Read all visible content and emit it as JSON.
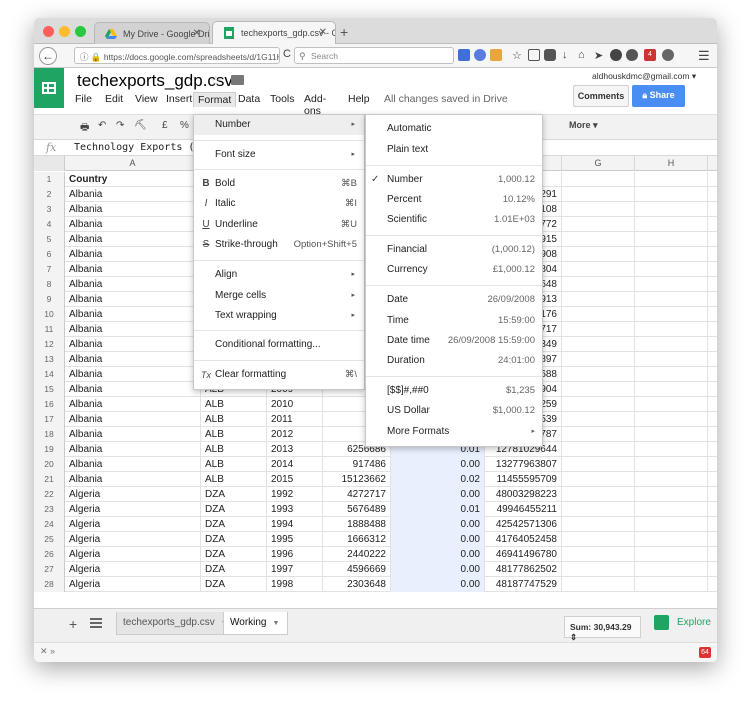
{
  "browser": {
    "tabs": [
      {
        "title": "My Drive - Google Drive"
      },
      {
        "title": "techexports_gdp.csv - Goo..."
      }
    ],
    "url": "https://docs.google.com/spreadsheets/d/1G11H",
    "search_placeholder": "Search",
    "extension_badge": "4",
    "bottom_badge": "64"
  },
  "app": {
    "doc_title": "techexports_gdp.csv",
    "menu": [
      "File",
      "Edit",
      "View",
      "Insert",
      "Format",
      "Data",
      "Tools",
      "Add-ons",
      "Help"
    ],
    "saved_status": "All changes saved in Drive",
    "account_email": "aldhouskdmc@gmail.com",
    "comments_label": "Comments",
    "share_label": "Share"
  },
  "toolbar": {
    "currency": "£",
    "percent": "%",
    "more": "More"
  },
  "formula_bar": {
    "fx": "fx",
    "content": "Technology Exports ($ b"
  },
  "sheet": {
    "column_headers": [
      "A",
      "",
      "",
      "",
      "",
      "",
      "G",
      "H"
    ],
    "rows": [
      {
        "n": "1",
        "a": "Country",
        "b": "",
        "c": "",
        "d": "",
        "e": "",
        "f": ""
      },
      {
        "n": "2",
        "a": "Albania",
        "b": "",
        "c": "",
        "d": "",
        "e": "",
        "f": "291"
      },
      {
        "n": "3",
        "a": "Albania",
        "b": "",
        "c": "",
        "d": "",
        "e": "",
        "f": "108"
      },
      {
        "n": "4",
        "a": "Albania",
        "b": "",
        "c": "",
        "d": "",
        "e": "",
        "f": "772"
      },
      {
        "n": "5",
        "a": "Albania",
        "b": "",
        "c": "",
        "d": "",
        "e": "",
        "f": "915"
      },
      {
        "n": "6",
        "a": "Albania",
        "b": "",
        "c": "",
        "d": "",
        "e": "",
        "f": "908"
      },
      {
        "n": "7",
        "a": "Albania",
        "b": "",
        "c": "",
        "d": "",
        "e": "",
        "f": "804"
      },
      {
        "n": "8",
        "a": "Albania",
        "b": "",
        "c": "",
        "d": "",
        "e": "",
        "f": "648"
      },
      {
        "n": "9",
        "a": "Albania",
        "b": "",
        "c": "",
        "d": "",
        "e": "",
        "f": "913"
      },
      {
        "n": "10",
        "a": "Albania",
        "b": "",
        "c": "",
        "d": "",
        "e": "",
        "f": "176"
      },
      {
        "n": "11",
        "a": "Albania",
        "b": "",
        "c": "",
        "d": "",
        "e": "",
        "f": "717"
      },
      {
        "n": "12",
        "a": "Albania",
        "b": "",
        "c": "",
        "d": "",
        "e": "",
        "f": "349"
      },
      {
        "n": "13",
        "a": "Albania",
        "b": "",
        "c": "",
        "d": "",
        "e": "",
        "f": "897"
      },
      {
        "n": "14",
        "a": "Albania",
        "b": "",
        "c": "",
        "d": "",
        "e": "",
        "f": "688"
      },
      {
        "n": "15",
        "a": "Albania",
        "b": "ALB",
        "c": "2009",
        "d": "583",
        "e": "",
        "f": "904"
      },
      {
        "n": "16",
        "a": "Albania",
        "b": "ALB",
        "c": "2010",
        "d": "858",
        "e": "",
        "f": "259"
      },
      {
        "n": "17",
        "a": "Albania",
        "b": "ALB",
        "c": "2011",
        "d": "620",
        "e": "",
        "f": "539"
      },
      {
        "n": "18",
        "a": "Albania",
        "b": "ALB",
        "c": "2012",
        "d": "481",
        "e": "",
        "f": "787"
      },
      {
        "n": "19",
        "a": "Albania",
        "b": "ALB",
        "c": "2013",
        "d": "6256686",
        "e": "0.01",
        "f": "12781029644"
      },
      {
        "n": "20",
        "a": "Albania",
        "b": "ALB",
        "c": "2014",
        "d": "917486",
        "e": "0.00",
        "f": "13277963807"
      },
      {
        "n": "21",
        "a": "Albania",
        "b": "ALB",
        "c": "2015",
        "d": "15123662",
        "e": "0.02",
        "f": "11455595709"
      },
      {
        "n": "22",
        "a": "Algeria",
        "b": "DZA",
        "c": "1992",
        "d": "4272717",
        "e": "0.00",
        "f": "48003298223"
      },
      {
        "n": "23",
        "a": "Algeria",
        "b": "DZA",
        "c": "1993",
        "d": "5676489",
        "e": "0.01",
        "f": "49946455211"
      },
      {
        "n": "24",
        "a": "Algeria",
        "b": "DZA",
        "c": "1994",
        "d": "1888488",
        "e": "0.00",
        "f": "42542571306"
      },
      {
        "n": "25",
        "a": "Algeria",
        "b": "DZA",
        "c": "1995",
        "d": "1666312",
        "e": "0.00",
        "f": "41764052458"
      },
      {
        "n": "26",
        "a": "Algeria",
        "b": "DZA",
        "c": "1996",
        "d": "2440222",
        "e": "0.00",
        "f": "46941496780"
      },
      {
        "n": "27",
        "a": "Algeria",
        "b": "DZA",
        "c": "1997",
        "d": "4596669",
        "e": "0.00",
        "f": "48177862502"
      },
      {
        "n": "28",
        "a": "Algeria",
        "b": "DZA",
        "c": "1998",
        "d": "2303648",
        "e": "0.00",
        "f": "48187747529"
      }
    ]
  },
  "format_menu": {
    "items": [
      {
        "label": "Number",
        "arrow": "▸",
        "icon": "",
        "shortcut": ""
      },
      {
        "label": "Font size",
        "arrow": "▸",
        "icon": "",
        "shortcut": ""
      },
      {
        "label": "Bold",
        "arrow": "",
        "icon": "B",
        "shortcut": "⌘B"
      },
      {
        "label": "Italic",
        "arrow": "",
        "icon": "I",
        "shortcut": "⌘I"
      },
      {
        "label": "Underline",
        "arrow": "",
        "icon": "U",
        "shortcut": "⌘U"
      },
      {
        "label": "Strike-through",
        "arrow": "",
        "icon": "S",
        "shortcut": "Option+Shift+5"
      },
      {
        "label": "Align",
        "arrow": "▸",
        "icon": "",
        "shortcut": ""
      },
      {
        "label": "Merge cells",
        "arrow": "▸",
        "icon": "",
        "shortcut": ""
      },
      {
        "label": "Text wrapping",
        "arrow": "▸",
        "icon": "",
        "shortcut": ""
      },
      {
        "label": "Conditional formatting...",
        "arrow": "",
        "icon": "",
        "shortcut": ""
      },
      {
        "label": "Clear formatting",
        "arrow": "",
        "icon": "Tx",
        "shortcut": "⌘\\"
      }
    ]
  },
  "number_menu": {
    "items": [
      {
        "label": "Automatic",
        "example": "",
        "checked": ""
      },
      {
        "label": "Plain text",
        "example": "",
        "checked": ""
      },
      {
        "label": "Number",
        "example": "1,000.12",
        "checked": "✓"
      },
      {
        "label": "Percent",
        "example": "10.12%",
        "checked": ""
      },
      {
        "label": "Scientific",
        "example": "1.01E+03",
        "checked": ""
      },
      {
        "label": "Financial",
        "example": "(1,000.12)",
        "checked": ""
      },
      {
        "label": "Currency",
        "example": "£1,000.12",
        "checked": ""
      },
      {
        "label": "Date",
        "example": "26/09/2008",
        "checked": ""
      },
      {
        "label": "Time",
        "example": "15:59:00",
        "checked": ""
      },
      {
        "label": "Date time",
        "example": "26/09/2008 15:59:00",
        "checked": ""
      },
      {
        "label": "Duration",
        "example": "24:01:00",
        "checked": ""
      },
      {
        "label": "[$$]#,##0",
        "example": "$1,235",
        "checked": ""
      },
      {
        "label": "US Dollar",
        "example": "$1,000.12",
        "checked": ""
      },
      {
        "label": "More Formats",
        "example": "▸",
        "checked": ""
      }
    ]
  },
  "bottom": {
    "sheet_tabs": [
      {
        "label": "techexports_gdp.csv"
      },
      {
        "label": "Working"
      }
    ],
    "sum_label": "Sum: 30,943.29",
    "explore_label": "Explore"
  }
}
